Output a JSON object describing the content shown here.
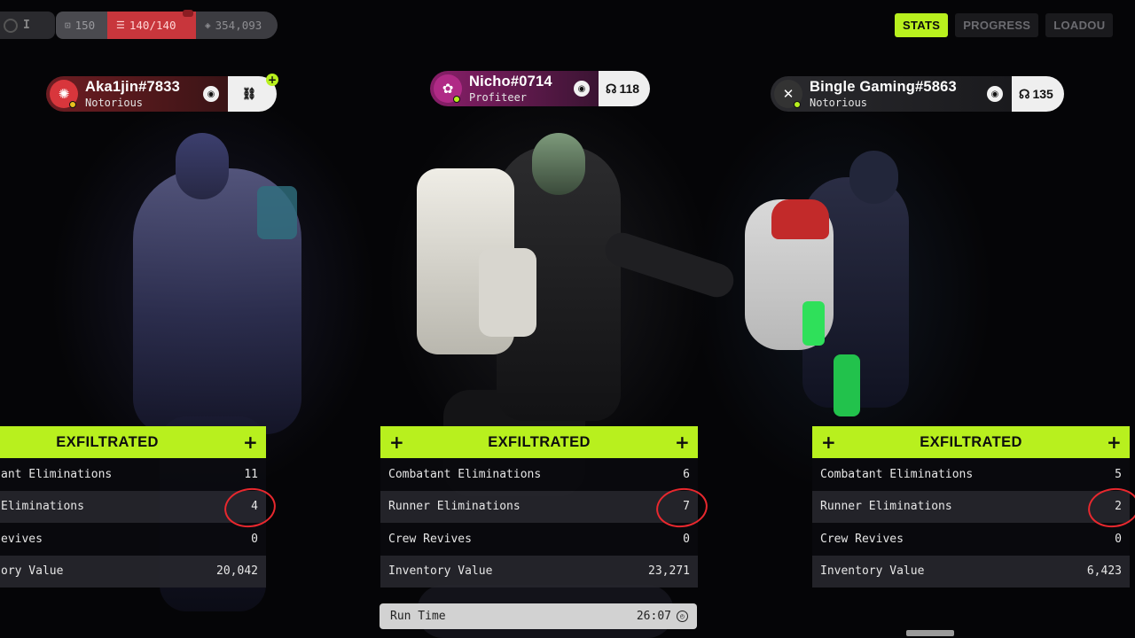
{
  "topbar": {
    "level_glyph": "I",
    "currency_1": "150",
    "capacity": "140/140",
    "credits": "354,093"
  },
  "tabs": [
    {
      "label": "STATS",
      "active": true
    },
    {
      "label": "PROGRESS",
      "active": false
    },
    {
      "label": "LOADOU",
      "active": false
    }
  ],
  "players": [
    {
      "name": "Aka1jin#7833",
      "rank": "Notorious",
      "avatar_color": "#d8363c",
      "chip": "",
      "chip_icon": "link-icon",
      "status": "EXFILTRATED",
      "stats": [
        {
          "label": "ant Eliminations",
          "value": "11"
        },
        {
          "label": " Eliminations",
          "value": "4"
        },
        {
          "label": "evives",
          "value": "0"
        },
        {
          "label": "ory Value",
          "value": "20,042"
        }
      ]
    },
    {
      "name": "Nicho#0714",
      "rank": "Profiteer",
      "avatar_color": "#b02a86",
      "chip": "118",
      "chip_icon": "headset-icon",
      "status": "EXFILTRATED",
      "stats": [
        {
          "label": "Combatant Eliminations",
          "value": "6"
        },
        {
          "label": "Runner Eliminations",
          "value": "7"
        },
        {
          "label": "Crew Revives",
          "value": "0"
        },
        {
          "label": "Inventory Value",
          "value": "23,271"
        }
      ]
    },
    {
      "name": "Bingle Gaming#5863",
      "rank": "Notorious",
      "avatar_color": "#333333",
      "chip": "135",
      "chip_icon": "headset-icon",
      "status": "EXFILTRATED",
      "stats": [
        {
          "label": "Combatant Eliminations",
          "value": "5"
        },
        {
          "label": "Runner Eliminations",
          "value": "2"
        },
        {
          "label": "Crew Revives",
          "value": "0"
        },
        {
          "label": "Inventory Value",
          "value": "6,423"
        }
      ]
    }
  ],
  "run_time": {
    "label": "Run Time",
    "value": "26:07"
  },
  "colors": {
    "accent": "#b8f01e",
    "alert": "#c8363c",
    "annotation": "#e8282e"
  }
}
